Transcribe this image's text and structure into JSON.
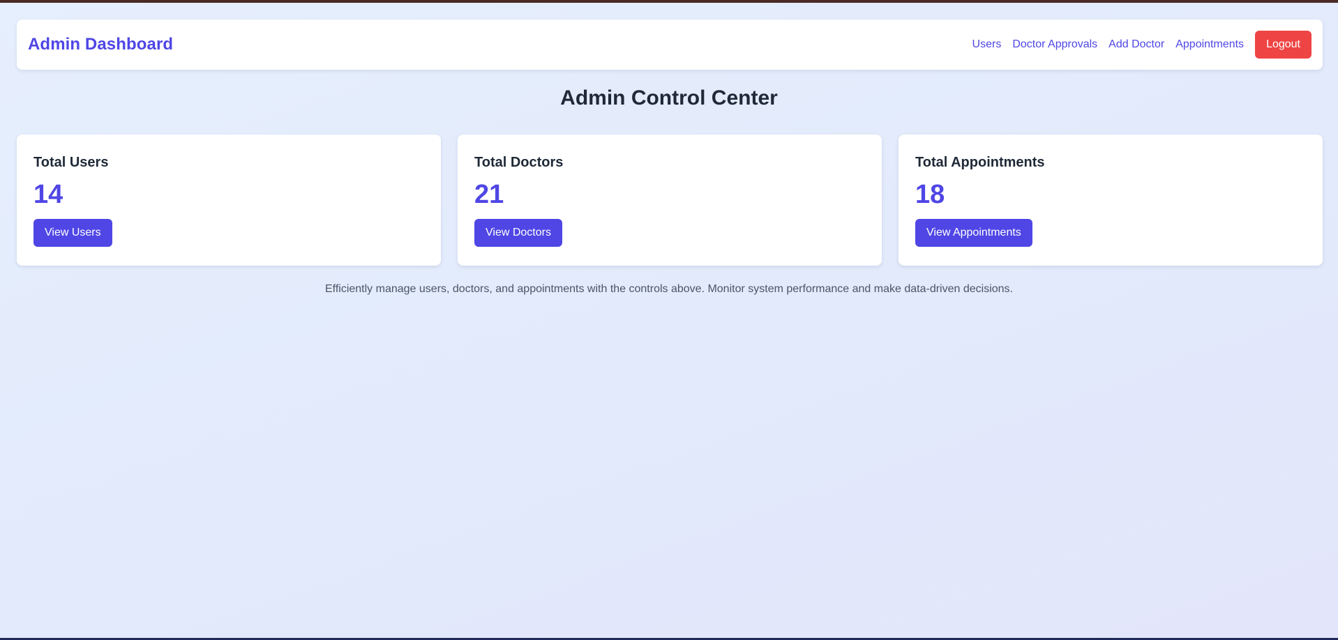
{
  "navbar": {
    "brand": "Admin Dashboard",
    "links": [
      {
        "label": "Users"
      },
      {
        "label": "Doctor Approvals"
      },
      {
        "label": "Add Doctor"
      },
      {
        "label": "Appointments"
      }
    ],
    "logout_label": "Logout"
  },
  "main": {
    "title": "Admin Control Center",
    "cards": [
      {
        "title": "Total Users",
        "value": "14",
        "button_label": "View Users"
      },
      {
        "title": "Total Doctors",
        "value": "21",
        "button_label": "View Doctors"
      },
      {
        "title": "Total Appointments",
        "value": "18",
        "button_label": "View Appointments"
      }
    ],
    "footer_text": "Efficiently manage users, doctors, and appointments with the controls above. Monitor system performance and make data-driven decisions."
  },
  "colors": {
    "accent": "#4f46e5",
    "danger": "#ef4444",
    "text": "#1f2937",
    "muted": "#4b5563"
  }
}
